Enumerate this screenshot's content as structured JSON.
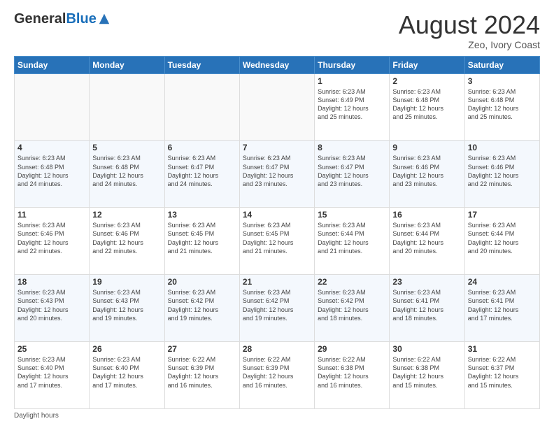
{
  "header": {
    "logo_general": "General",
    "logo_blue": "Blue",
    "month_title": "August 2024",
    "location": "Zeo, Ivory Coast"
  },
  "footer": {
    "daylight_label": "Daylight hours"
  },
  "calendar": {
    "headers": [
      "Sunday",
      "Monday",
      "Tuesday",
      "Wednesday",
      "Thursday",
      "Friday",
      "Saturday"
    ],
    "weeks": [
      [
        {
          "num": "",
          "info": ""
        },
        {
          "num": "",
          "info": ""
        },
        {
          "num": "",
          "info": ""
        },
        {
          "num": "",
          "info": ""
        },
        {
          "num": "1",
          "info": "Sunrise: 6:23 AM\nSunset: 6:49 PM\nDaylight: 12 hours\nand 25 minutes."
        },
        {
          "num": "2",
          "info": "Sunrise: 6:23 AM\nSunset: 6:48 PM\nDaylight: 12 hours\nand 25 minutes."
        },
        {
          "num": "3",
          "info": "Sunrise: 6:23 AM\nSunset: 6:48 PM\nDaylight: 12 hours\nand 25 minutes."
        }
      ],
      [
        {
          "num": "4",
          "info": "Sunrise: 6:23 AM\nSunset: 6:48 PM\nDaylight: 12 hours\nand 24 minutes."
        },
        {
          "num": "5",
          "info": "Sunrise: 6:23 AM\nSunset: 6:48 PM\nDaylight: 12 hours\nand 24 minutes."
        },
        {
          "num": "6",
          "info": "Sunrise: 6:23 AM\nSunset: 6:47 PM\nDaylight: 12 hours\nand 24 minutes."
        },
        {
          "num": "7",
          "info": "Sunrise: 6:23 AM\nSunset: 6:47 PM\nDaylight: 12 hours\nand 23 minutes."
        },
        {
          "num": "8",
          "info": "Sunrise: 6:23 AM\nSunset: 6:47 PM\nDaylight: 12 hours\nand 23 minutes."
        },
        {
          "num": "9",
          "info": "Sunrise: 6:23 AM\nSunset: 6:46 PM\nDaylight: 12 hours\nand 23 minutes."
        },
        {
          "num": "10",
          "info": "Sunrise: 6:23 AM\nSunset: 6:46 PM\nDaylight: 12 hours\nand 22 minutes."
        }
      ],
      [
        {
          "num": "11",
          "info": "Sunrise: 6:23 AM\nSunset: 6:46 PM\nDaylight: 12 hours\nand 22 minutes."
        },
        {
          "num": "12",
          "info": "Sunrise: 6:23 AM\nSunset: 6:46 PM\nDaylight: 12 hours\nand 22 minutes."
        },
        {
          "num": "13",
          "info": "Sunrise: 6:23 AM\nSunset: 6:45 PM\nDaylight: 12 hours\nand 21 minutes."
        },
        {
          "num": "14",
          "info": "Sunrise: 6:23 AM\nSunset: 6:45 PM\nDaylight: 12 hours\nand 21 minutes."
        },
        {
          "num": "15",
          "info": "Sunrise: 6:23 AM\nSunset: 6:44 PM\nDaylight: 12 hours\nand 21 minutes."
        },
        {
          "num": "16",
          "info": "Sunrise: 6:23 AM\nSunset: 6:44 PM\nDaylight: 12 hours\nand 20 minutes."
        },
        {
          "num": "17",
          "info": "Sunrise: 6:23 AM\nSunset: 6:44 PM\nDaylight: 12 hours\nand 20 minutes."
        }
      ],
      [
        {
          "num": "18",
          "info": "Sunrise: 6:23 AM\nSunset: 6:43 PM\nDaylight: 12 hours\nand 20 minutes."
        },
        {
          "num": "19",
          "info": "Sunrise: 6:23 AM\nSunset: 6:43 PM\nDaylight: 12 hours\nand 19 minutes."
        },
        {
          "num": "20",
          "info": "Sunrise: 6:23 AM\nSunset: 6:42 PM\nDaylight: 12 hours\nand 19 minutes."
        },
        {
          "num": "21",
          "info": "Sunrise: 6:23 AM\nSunset: 6:42 PM\nDaylight: 12 hours\nand 19 minutes."
        },
        {
          "num": "22",
          "info": "Sunrise: 6:23 AM\nSunset: 6:42 PM\nDaylight: 12 hours\nand 18 minutes."
        },
        {
          "num": "23",
          "info": "Sunrise: 6:23 AM\nSunset: 6:41 PM\nDaylight: 12 hours\nand 18 minutes."
        },
        {
          "num": "24",
          "info": "Sunrise: 6:23 AM\nSunset: 6:41 PM\nDaylight: 12 hours\nand 17 minutes."
        }
      ],
      [
        {
          "num": "25",
          "info": "Sunrise: 6:23 AM\nSunset: 6:40 PM\nDaylight: 12 hours\nand 17 minutes."
        },
        {
          "num": "26",
          "info": "Sunrise: 6:23 AM\nSunset: 6:40 PM\nDaylight: 12 hours\nand 17 minutes."
        },
        {
          "num": "27",
          "info": "Sunrise: 6:22 AM\nSunset: 6:39 PM\nDaylight: 12 hours\nand 16 minutes."
        },
        {
          "num": "28",
          "info": "Sunrise: 6:22 AM\nSunset: 6:39 PM\nDaylight: 12 hours\nand 16 minutes."
        },
        {
          "num": "29",
          "info": "Sunrise: 6:22 AM\nSunset: 6:38 PM\nDaylight: 12 hours\nand 16 minutes."
        },
        {
          "num": "30",
          "info": "Sunrise: 6:22 AM\nSunset: 6:38 PM\nDaylight: 12 hours\nand 15 minutes."
        },
        {
          "num": "31",
          "info": "Sunrise: 6:22 AM\nSunset: 6:37 PM\nDaylight: 12 hours\nand 15 minutes."
        }
      ]
    ]
  }
}
